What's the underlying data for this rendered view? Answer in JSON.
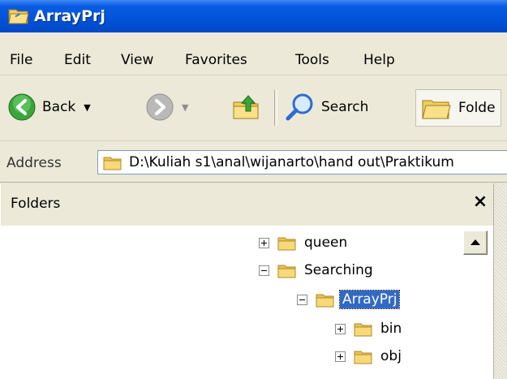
{
  "window": {
    "title": "ArrayPrj"
  },
  "menu": {
    "items": [
      "File",
      "Edit",
      "View",
      "Favorites",
      "Tools",
      "Help"
    ]
  },
  "toolbar": {
    "back_label": "Back",
    "search_label": "Search",
    "folders_label": "Folde"
  },
  "address": {
    "label": "Address",
    "path": "D:\\Kuliah s1\\anal\\wijanarto\\hand out\\Praktikum"
  },
  "folders_panel": {
    "title": "Folders",
    "close_glyph": "×",
    "tree": [
      {
        "label": "queen",
        "expander": "plus",
        "selected": false
      },
      {
        "label": "Searching",
        "expander": "minus",
        "selected": false
      },
      {
        "label": "ArrayPrj",
        "expander": "minus",
        "selected": true
      },
      {
        "label": "bin",
        "expander": "plus",
        "selected": false
      },
      {
        "label": "obj",
        "expander": "plus",
        "selected": false
      }
    ]
  },
  "colors": {
    "title_bar": "#0052d8",
    "selection": "#316ac5",
    "chrome": "#ece9d8"
  }
}
